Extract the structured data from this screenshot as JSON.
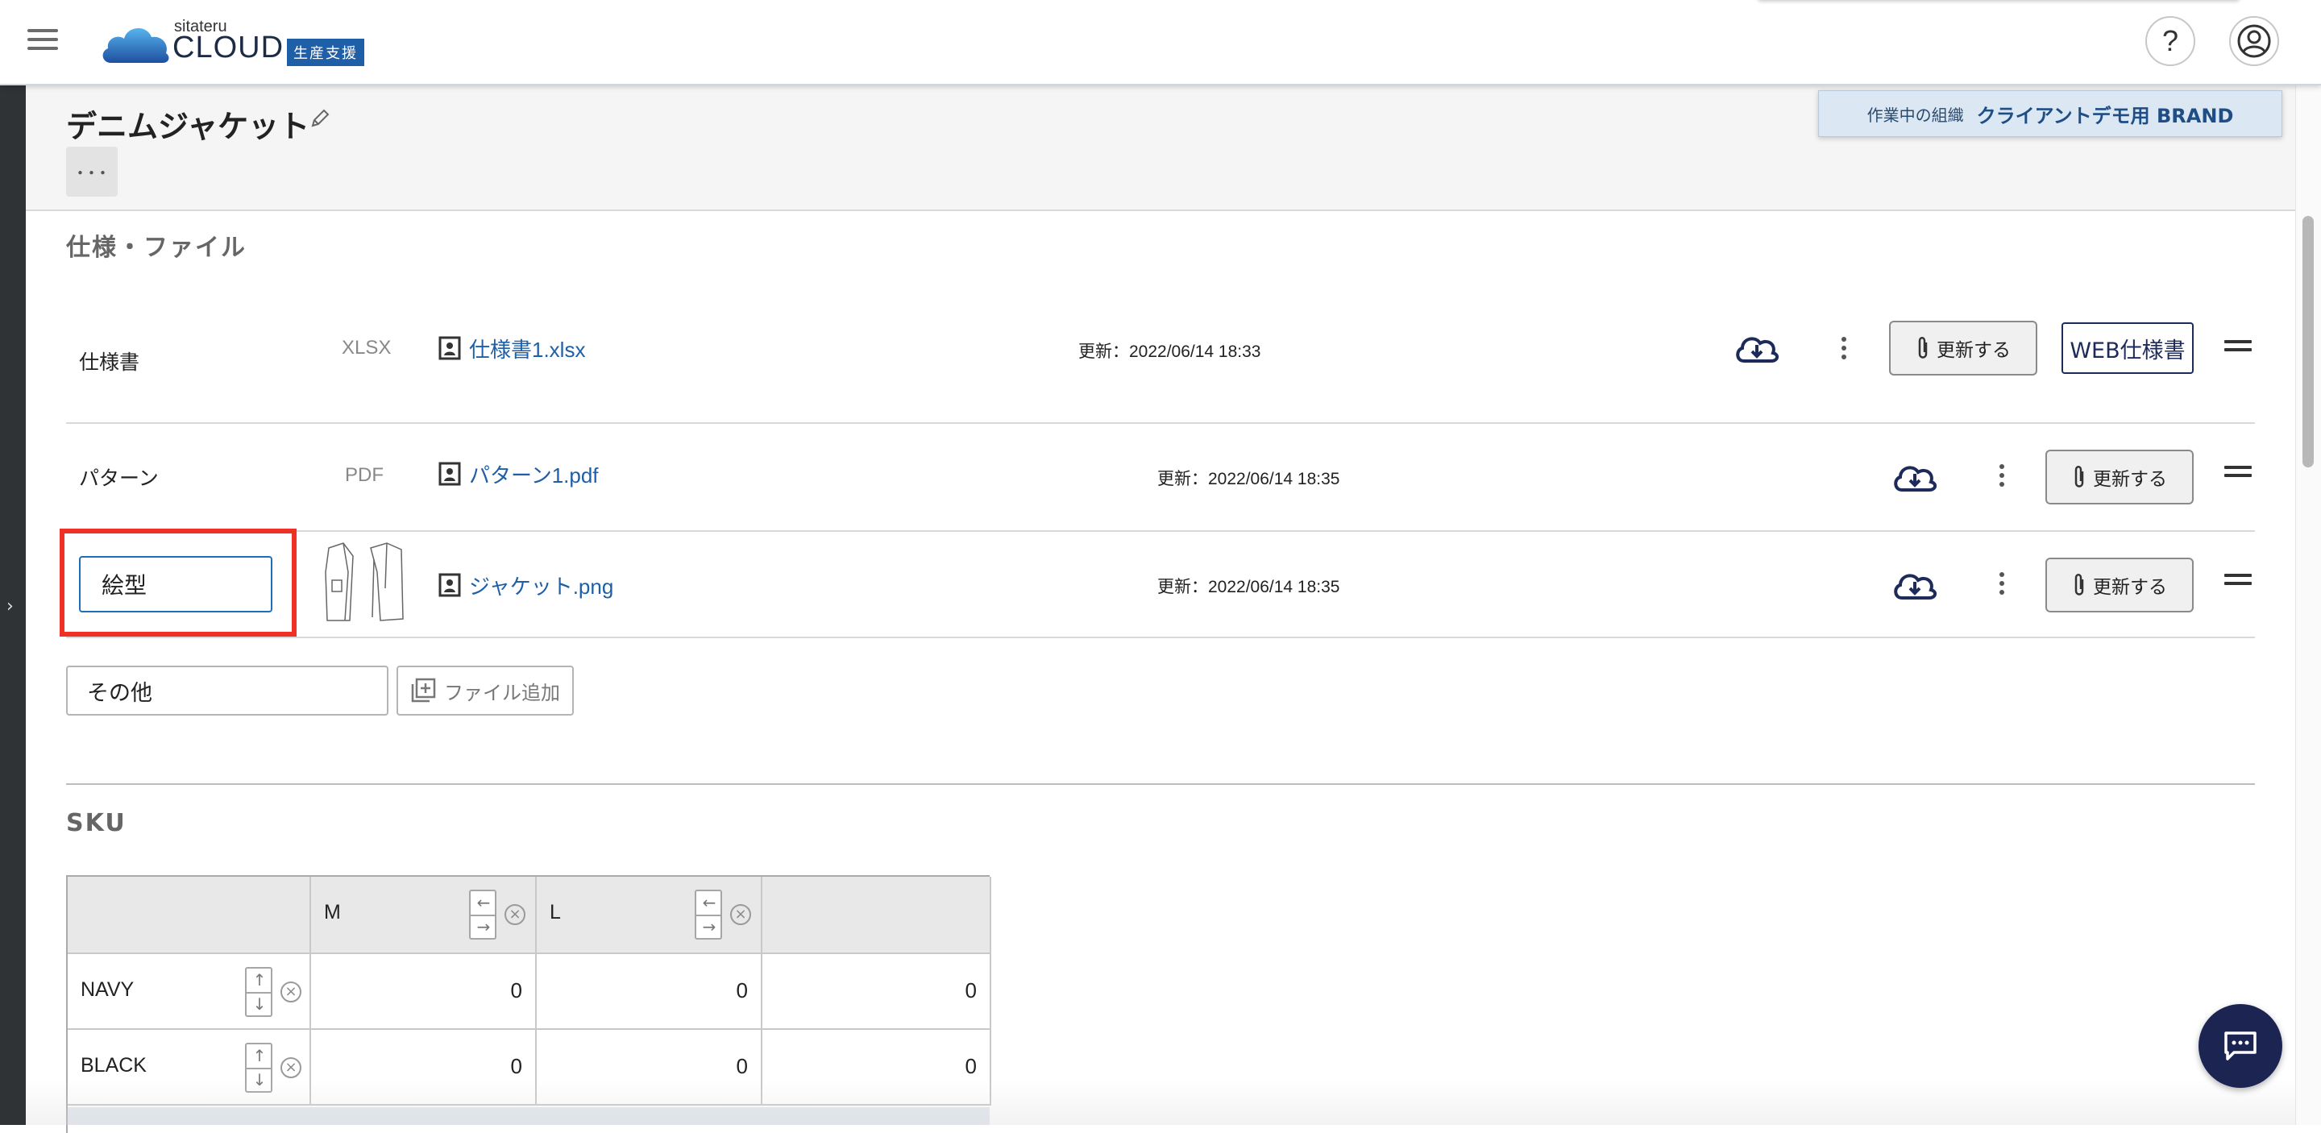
{
  "header": {
    "logo_small": "sitateru",
    "logo_big": "CLOUD",
    "logo_badge": "生産支援",
    "help_label": "?"
  },
  "org": {
    "label": "作業中の組織",
    "value": "クライアントデモ用 BRAND"
  },
  "page": {
    "title": "デニムジャケット",
    "more_label": "･･･"
  },
  "files_section": {
    "title": "仕様・ファイル",
    "rows": [
      {
        "label": "仕様書",
        "type": "XLSX",
        "file": "仕様書1.xlsx",
        "updated": "更新：2022/06/14 18:33",
        "update_btn": "更新する",
        "web_btn": "WEB仕様書"
      },
      {
        "label": "パターン",
        "type": "PDF",
        "file": "パターン1.pdf",
        "updated": "更新：2022/06/14 18:35",
        "update_btn": "更新する"
      },
      {
        "label_input_value": "絵型",
        "file": "ジャケット.png",
        "updated": "更新：2022/06/14 18:35",
        "update_btn": "更新する"
      }
    ],
    "other_input_value": "その他",
    "add_file_label": "ファイル追加"
  },
  "sku_section": {
    "title": "SKU",
    "columns": [
      "M",
      "L"
    ],
    "rows": [
      {
        "label": "NAVY",
        "values": [
          "0",
          "0",
          "0"
        ]
      },
      {
        "label": "BLACK",
        "values": [
          "0",
          "0",
          "0"
        ]
      }
    ]
  },
  "colors": {
    "link": "#1f5fa7",
    "highlight": "#ee3124",
    "chat": "#1c2552",
    "navy": "#1d2b5a"
  },
  "icons": [
    "hamburger-icon",
    "cloud-logo-icon",
    "help-icon",
    "account-icon",
    "pencil-icon",
    "file-icon",
    "cloud-download-icon",
    "kebab-icon",
    "paperclip-icon",
    "drag-handle-icon",
    "add-file-icon",
    "arrow-left-icon",
    "arrow-right-icon",
    "arrow-up-icon",
    "arrow-down-icon",
    "remove-icon",
    "chat-icon"
  ]
}
